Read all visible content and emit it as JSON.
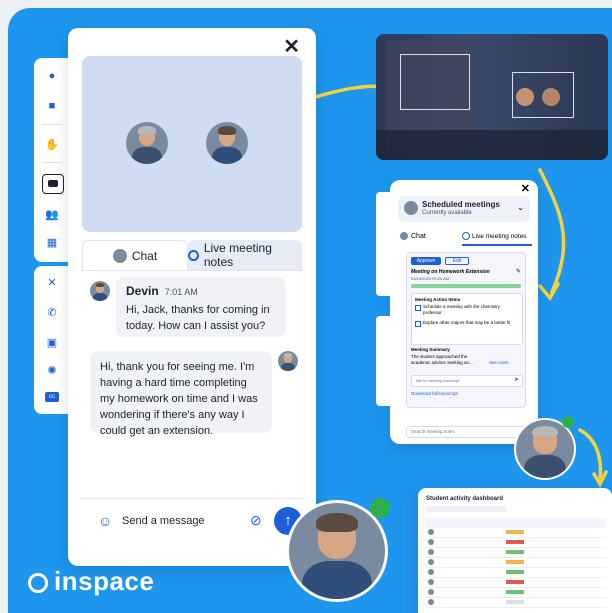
{
  "main_window": {
    "close_label": "✕",
    "tabs": [
      {
        "label": "Chat"
      },
      {
        "label": "Live meeting notes"
      }
    ],
    "messages": [
      {
        "sender": "Devin",
        "time": "7:01 AM",
        "text": "Hi, Jack, thanks for coming in today. How can I assist you?"
      },
      {
        "sender": "",
        "time": "",
        "text": "Hi, thank you for seeing me. I'm having a hard time completing my homework on time and I was wondering if there's any way I could get an extension."
      }
    ],
    "input": {
      "placeholder": "Send a message"
    },
    "send_label": "↑"
  },
  "side_panel": {
    "close_label": "✕",
    "title": "Scheduled meetings",
    "subtitle": "Currently available",
    "tabs": [
      {
        "label": "Chat"
      },
      {
        "label": "Live meeting notes"
      }
    ],
    "approve_label": "Approve",
    "edit_label": "Edit",
    "meeting_title": "Meeting on Homework Extension",
    "date": "03/14/2023 09:20 AM",
    "action_items_heading": "Meeting Action Items",
    "action_items": [
      "Schedule a meeting with the chemistry professor",
      "Explore other majors that may be a better fit"
    ],
    "summary_heading": "Meeting Summary",
    "summary_text": "The student approached the academic advisor seeking an...",
    "see_more_label": "See more",
    "transcript_placeholder": "Talk to meeting transcript",
    "download_label": "Download full transcript",
    "search_placeholder": "Search meeting notes"
  },
  "dashboard": {
    "title": "Student activity dashboard",
    "row_count": 9
  },
  "brand": {
    "name": "inspace"
  },
  "colors": {
    "background": "#1e96ee",
    "accent": "#1c5fd6",
    "yellow": "#f7d23a",
    "green": "#2fae4a"
  }
}
